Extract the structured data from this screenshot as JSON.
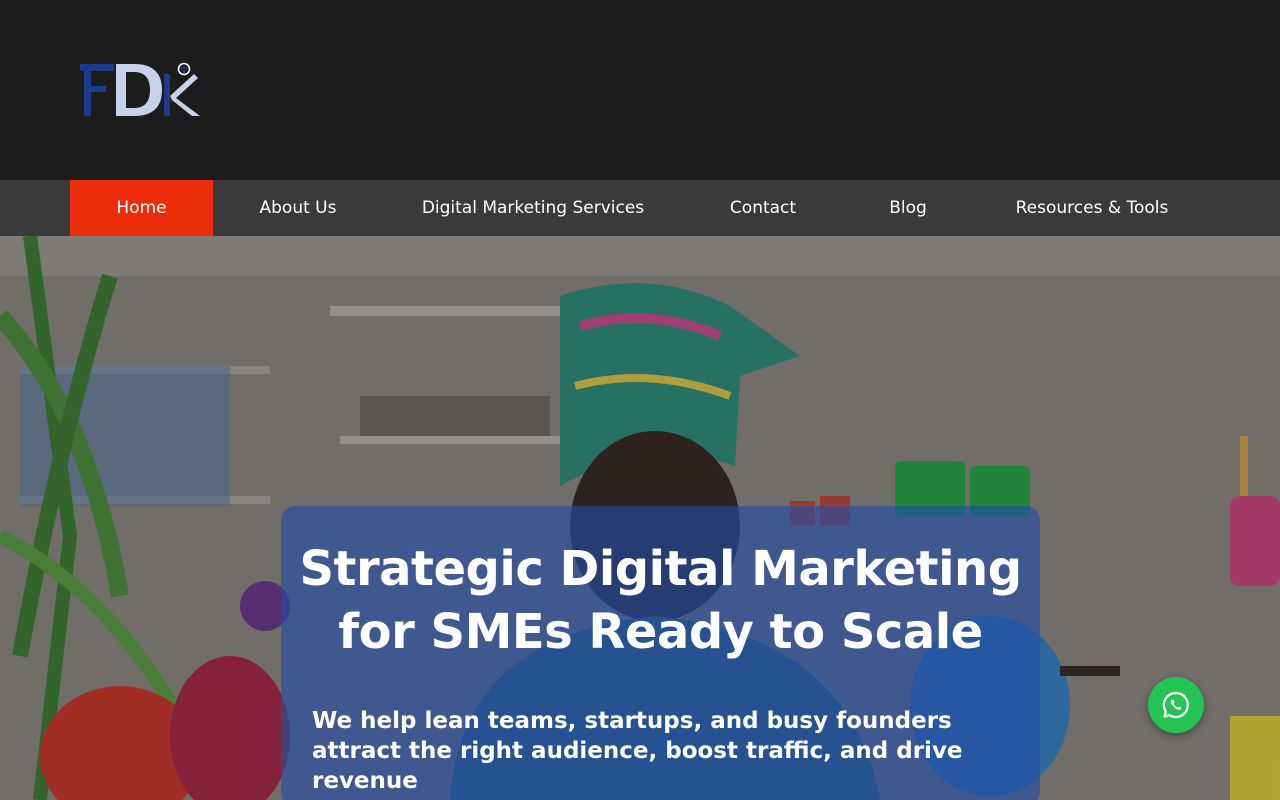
{
  "brand": {
    "logo_text": "FDK"
  },
  "nav": {
    "items": [
      {
        "label": "Home",
        "active": true
      },
      {
        "label": "About Us",
        "active": false
      },
      {
        "label": "Digital Marketing Services",
        "active": false
      },
      {
        "label": "Contact",
        "active": false
      },
      {
        "label": "Blog",
        "active": false
      },
      {
        "label": "Resources & Tools",
        "active": false
      }
    ]
  },
  "hero": {
    "title": "Strategic Digital Marketing for SMEs Ready to Scale",
    "subtitle": "We help lean teams, startups, and busy founders attract the right audience, boost traffic, and drive revenue"
  },
  "floating": {
    "icon": "whatsapp-icon"
  },
  "colors": {
    "header_bg": "#1c1c1d",
    "nav_bg": "#3a3a3a",
    "nav_active": "#ec2d0b",
    "hero_card": "#214ea8",
    "whatsapp": "#25c554"
  }
}
